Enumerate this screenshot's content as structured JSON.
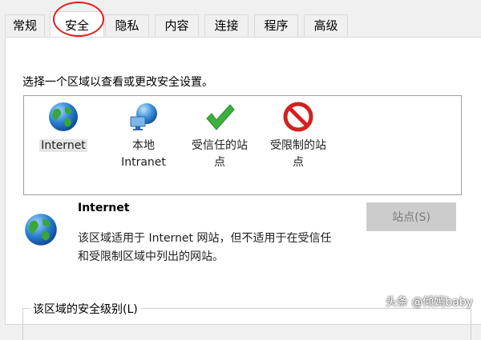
{
  "tabs": [
    {
      "label": "常规"
    },
    {
      "label": "安全"
    },
    {
      "label": "隐私"
    },
    {
      "label": "内容"
    },
    {
      "label": "连接"
    },
    {
      "label": "程序"
    },
    {
      "label": "高级"
    }
  ],
  "active_tab": "安全",
  "instruction": "选择一个区域以查看或更改安全设置。",
  "zones": [
    {
      "line1": "Internet",
      "line2": "",
      "icon": "globe-icon"
    },
    {
      "line1": "本地",
      "line2": "Intranet",
      "icon": "network-globe-icon"
    },
    {
      "line1": "受信任的站",
      "line2": "点",
      "icon": "checkmark-icon"
    },
    {
      "line1": "受限制的站",
      "line2": "点",
      "icon": "prohibited-icon"
    }
  ],
  "selected_zone": "Internet",
  "description": {
    "title": "Internet",
    "line1": "该区域适用于 Internet 网站，但不适用于在受信任",
    "line2": "和受限制区域中列出的网站。"
  },
  "sites_button": "站点(S)",
  "security_level_label": "该区域的安全级别(L)",
  "watermark": "头条 @倾嫣baby",
  "colors": {
    "highlight_circle": "#e02020",
    "check_green": "#3db03d",
    "prohibit_red": "#d42020"
  }
}
